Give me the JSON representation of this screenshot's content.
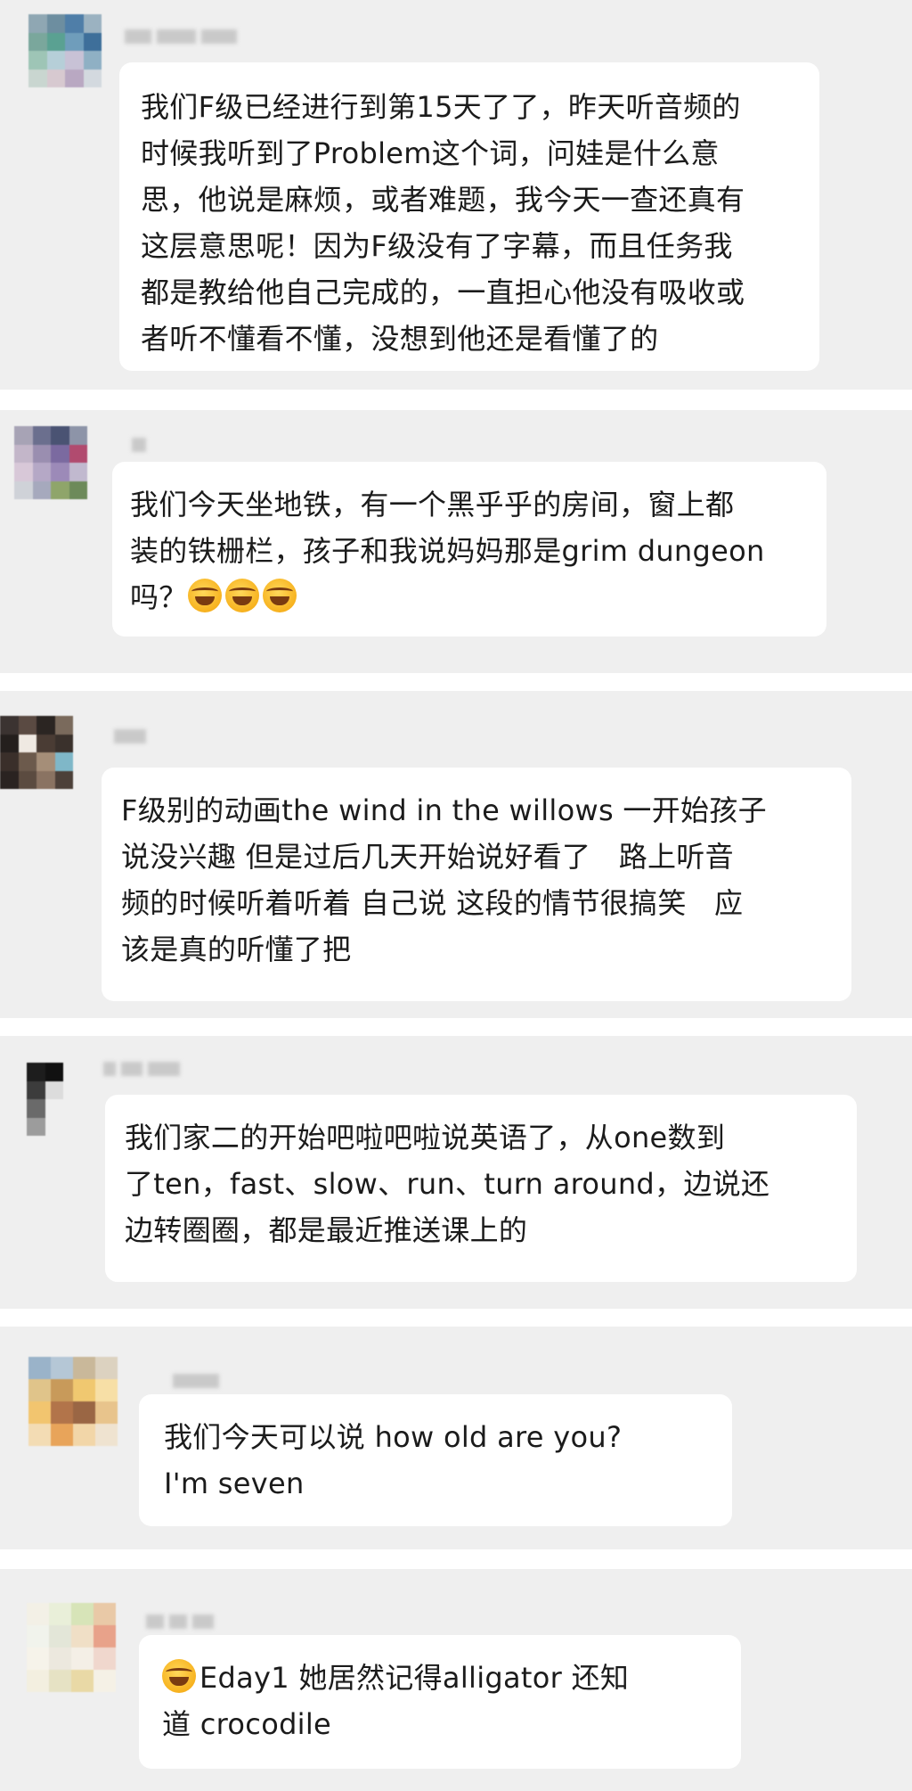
{
  "messages": [
    {
      "text": "我们F级已经进行到第15天了了，昨天听音频的\n时候我听到了Problem这个词，问娃是什么意\n思，他说是麻烦，或者难题，我今天一查还真有\n这层意思呢！因为F级没有了字幕，而且任务我\n都是教给他自己完成的，一直担心他没有吸收或\n者听不懂看不懂，没想到他还是看懂了的"
    },
    {
      "text": "我们今天坐地铁，有一个黑乎乎的房间，窗上都\n装的铁栅栏，孩子和我说妈妈那是grim dungeon\n吗？",
      "emojis": [
        "laughing-crying-emoji",
        "laughing-crying-emoji",
        "laughing-crying-emoji"
      ]
    },
    {
      "text": "F级别的动画the wind in the willows 一开始孩子\n说没兴趣 但是过后几天开始说好看了   路上听音\n频的时候听着听着 自己说 这段的情节很搞笑   应\n该是真的听懂了把"
    },
    {
      "text": "我们家二的开始吧啦吧啦说英语了，从one数到\n了ten，fast、slow、run、turn around，边说还\n边转圈圈，都是最近推送课上的"
    },
    {
      "text": "我们今天可以说 how old are you?\nI'm seven"
    },
    {
      "lead_emoji": "laughing-crying-emoji",
      "text": "Eday1 她居然记得alligator 还知\n道 crocodile"
    }
  ],
  "colors": {
    "card_background": "#efefef",
    "bubble_background": "#ffffff",
    "text": "#1b1b1b"
  }
}
